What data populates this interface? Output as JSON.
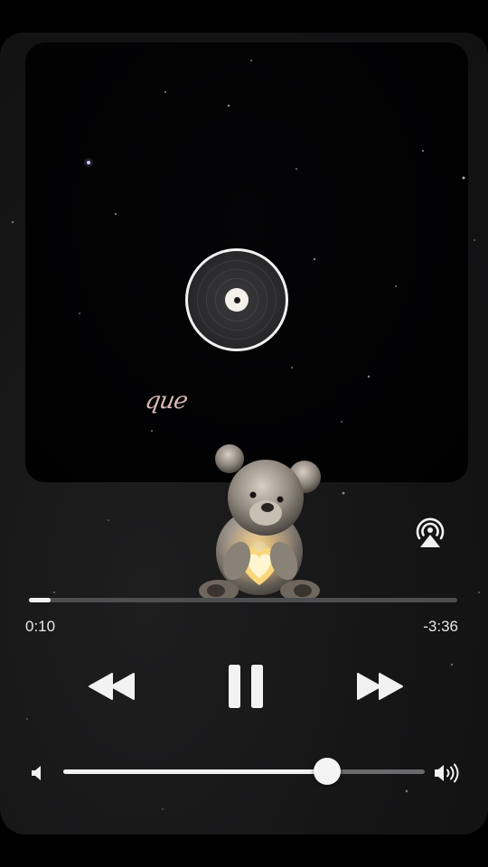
{
  "artwork": {
    "overlay_text": "que"
  },
  "playback": {
    "elapsed": "0:10",
    "remaining": "-3:36",
    "progress_fraction": 0.05
  },
  "volume": {
    "level_fraction": 0.73
  },
  "icons": {
    "airplay": "airplay-icon",
    "rewind": "rewind-icon",
    "pause": "pause-icon",
    "forward": "fast-forward-icon",
    "volume_low": "volume-low-icon",
    "volume_high": "volume-high-icon",
    "disc": "vinyl-disc-icon"
  },
  "colors": {
    "accent": "#f2f2f2",
    "track": "#4e4e50",
    "background": "#141415"
  }
}
